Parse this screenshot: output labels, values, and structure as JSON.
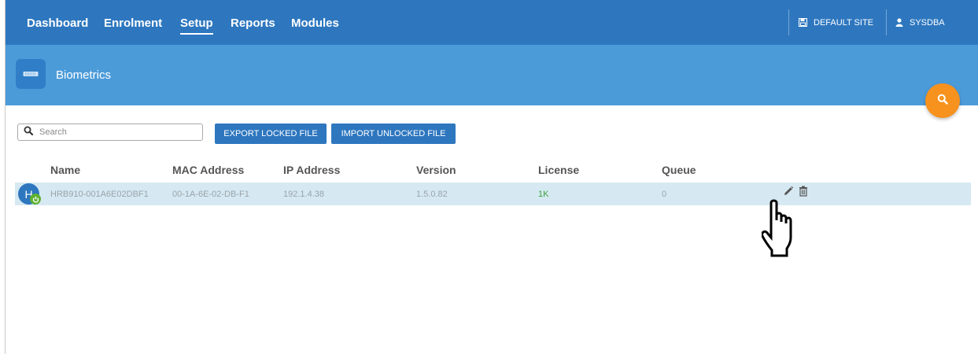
{
  "nav": {
    "items": [
      {
        "label": "Dashboard"
      },
      {
        "label": "Enrolment"
      },
      {
        "label": "Setup"
      },
      {
        "label": "Reports"
      },
      {
        "label": "Modules"
      }
    ],
    "active": "Setup",
    "site_label": "DEFAULT SITE",
    "user_label": "SYSDBA"
  },
  "page": {
    "title": "Biometrics"
  },
  "toolbar": {
    "search_placeholder": "Search",
    "export_label": "EXPORT LOCKED FILE",
    "import_label": "IMPORT UNLOCKED FILE"
  },
  "table": {
    "columns": [
      "Name",
      "MAC Address",
      "IP Address",
      "Version",
      "License",
      "Queue"
    ],
    "rows": [
      {
        "avatar_letter": "H",
        "name": "HRB910-001A6E02DBF1",
        "mac": "00-1A-6E-02-DB-F1",
        "ip": "192.1.4.38",
        "version": "1.5.0.82",
        "license": "1K",
        "queue": "0",
        "status_icon": "power-icon"
      }
    ]
  },
  "colors": {
    "nav_bg": "#2e77bf",
    "band_bg": "#4c9bd9",
    "fab": "#f7921e",
    "row_highlight": "#d6e9f2",
    "license_green": "#3da33d"
  }
}
